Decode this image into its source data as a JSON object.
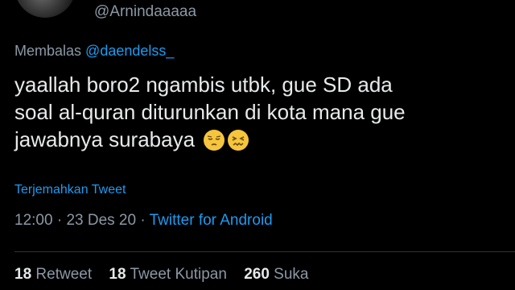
{
  "author": {
    "handle": "@Arnindaaaaa"
  },
  "reply": {
    "prefix": "Membalas",
    "mention": "@daendelss_"
  },
  "tweet": {
    "line1": "yaallah boro2 ngambis utbk, gue SD ada",
    "line2": "soal al-quran diturunkan di kota mana gue",
    "line3": "jawabnya surabaya",
    "emojis": [
      "pensive-face-icon",
      "confounded-face-icon"
    ]
  },
  "translate_label": "Terjemahkan Tweet",
  "meta": {
    "time": "12:00",
    "sep1": " · ",
    "date": "23 Des 20",
    "sep2": " · ",
    "source": "Twitter for Android"
  },
  "stats": {
    "retweets": {
      "count": "18",
      "label": "Retweet"
    },
    "quotes": {
      "count": "18",
      "label": "Tweet Kutipan"
    },
    "likes": {
      "count": "260",
      "label": "Suka"
    }
  },
  "colors": {
    "background": "#000000",
    "link": "#1d9bf0",
    "muted": "#8b98a5",
    "text": "#e7e9ea",
    "emoji": "#f5c53d"
  }
}
